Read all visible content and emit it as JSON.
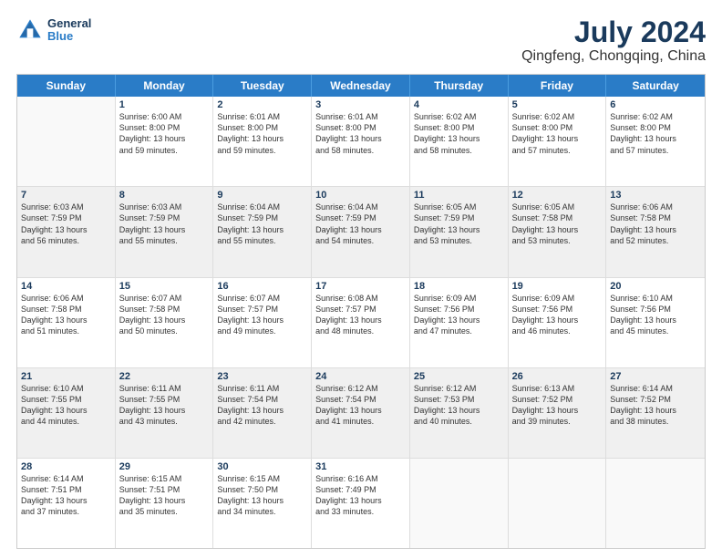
{
  "logo": {
    "line1": "General",
    "line2": "Blue"
  },
  "title": "July 2024",
  "subtitle": "Qingfeng, Chongqing, China",
  "weekdays": [
    "Sunday",
    "Monday",
    "Tuesday",
    "Wednesday",
    "Thursday",
    "Friday",
    "Saturday"
  ],
  "weeks": [
    [
      {
        "day": "",
        "content": [],
        "empty": true
      },
      {
        "day": "1",
        "content": [
          "Sunrise: 6:00 AM",
          "Sunset: 8:00 PM",
          "Daylight: 13 hours",
          "and 59 minutes."
        ]
      },
      {
        "day": "2",
        "content": [
          "Sunrise: 6:01 AM",
          "Sunset: 8:00 PM",
          "Daylight: 13 hours",
          "and 59 minutes."
        ]
      },
      {
        "day": "3",
        "content": [
          "Sunrise: 6:01 AM",
          "Sunset: 8:00 PM",
          "Daylight: 13 hours",
          "and 58 minutes."
        ]
      },
      {
        "day": "4",
        "content": [
          "Sunrise: 6:02 AM",
          "Sunset: 8:00 PM",
          "Daylight: 13 hours",
          "and 58 minutes."
        ]
      },
      {
        "day": "5",
        "content": [
          "Sunrise: 6:02 AM",
          "Sunset: 8:00 PM",
          "Daylight: 13 hours",
          "and 57 minutes."
        ]
      },
      {
        "day": "6",
        "content": [
          "Sunrise: 6:02 AM",
          "Sunset: 8:00 PM",
          "Daylight: 13 hours",
          "and 57 minutes."
        ]
      }
    ],
    [
      {
        "day": "7",
        "content": [
          "Sunrise: 6:03 AM",
          "Sunset: 7:59 PM",
          "Daylight: 13 hours",
          "and 56 minutes."
        ],
        "shaded": true
      },
      {
        "day": "8",
        "content": [
          "Sunrise: 6:03 AM",
          "Sunset: 7:59 PM",
          "Daylight: 13 hours",
          "and 55 minutes."
        ],
        "shaded": true
      },
      {
        "day": "9",
        "content": [
          "Sunrise: 6:04 AM",
          "Sunset: 7:59 PM",
          "Daylight: 13 hours",
          "and 55 minutes."
        ],
        "shaded": true
      },
      {
        "day": "10",
        "content": [
          "Sunrise: 6:04 AM",
          "Sunset: 7:59 PM",
          "Daylight: 13 hours",
          "and 54 minutes."
        ],
        "shaded": true
      },
      {
        "day": "11",
        "content": [
          "Sunrise: 6:05 AM",
          "Sunset: 7:59 PM",
          "Daylight: 13 hours",
          "and 53 minutes."
        ],
        "shaded": true
      },
      {
        "day": "12",
        "content": [
          "Sunrise: 6:05 AM",
          "Sunset: 7:58 PM",
          "Daylight: 13 hours",
          "and 53 minutes."
        ],
        "shaded": true
      },
      {
        "day": "13",
        "content": [
          "Sunrise: 6:06 AM",
          "Sunset: 7:58 PM",
          "Daylight: 13 hours",
          "and 52 minutes."
        ],
        "shaded": true
      }
    ],
    [
      {
        "day": "14",
        "content": [
          "Sunrise: 6:06 AM",
          "Sunset: 7:58 PM",
          "Daylight: 13 hours",
          "and 51 minutes."
        ]
      },
      {
        "day": "15",
        "content": [
          "Sunrise: 6:07 AM",
          "Sunset: 7:58 PM",
          "Daylight: 13 hours",
          "and 50 minutes."
        ]
      },
      {
        "day": "16",
        "content": [
          "Sunrise: 6:07 AM",
          "Sunset: 7:57 PM",
          "Daylight: 13 hours",
          "and 49 minutes."
        ]
      },
      {
        "day": "17",
        "content": [
          "Sunrise: 6:08 AM",
          "Sunset: 7:57 PM",
          "Daylight: 13 hours",
          "and 48 minutes."
        ]
      },
      {
        "day": "18",
        "content": [
          "Sunrise: 6:09 AM",
          "Sunset: 7:56 PM",
          "Daylight: 13 hours",
          "and 47 minutes."
        ]
      },
      {
        "day": "19",
        "content": [
          "Sunrise: 6:09 AM",
          "Sunset: 7:56 PM",
          "Daylight: 13 hours",
          "and 46 minutes."
        ]
      },
      {
        "day": "20",
        "content": [
          "Sunrise: 6:10 AM",
          "Sunset: 7:56 PM",
          "Daylight: 13 hours",
          "and 45 minutes."
        ]
      }
    ],
    [
      {
        "day": "21",
        "content": [
          "Sunrise: 6:10 AM",
          "Sunset: 7:55 PM",
          "Daylight: 13 hours",
          "and 44 minutes."
        ],
        "shaded": true
      },
      {
        "day": "22",
        "content": [
          "Sunrise: 6:11 AM",
          "Sunset: 7:55 PM",
          "Daylight: 13 hours",
          "and 43 minutes."
        ],
        "shaded": true
      },
      {
        "day": "23",
        "content": [
          "Sunrise: 6:11 AM",
          "Sunset: 7:54 PM",
          "Daylight: 13 hours",
          "and 42 minutes."
        ],
        "shaded": true
      },
      {
        "day": "24",
        "content": [
          "Sunrise: 6:12 AM",
          "Sunset: 7:54 PM",
          "Daylight: 13 hours",
          "and 41 minutes."
        ],
        "shaded": true
      },
      {
        "day": "25",
        "content": [
          "Sunrise: 6:12 AM",
          "Sunset: 7:53 PM",
          "Daylight: 13 hours",
          "and 40 minutes."
        ],
        "shaded": true
      },
      {
        "day": "26",
        "content": [
          "Sunrise: 6:13 AM",
          "Sunset: 7:52 PM",
          "Daylight: 13 hours",
          "and 39 minutes."
        ],
        "shaded": true
      },
      {
        "day": "27",
        "content": [
          "Sunrise: 6:14 AM",
          "Sunset: 7:52 PM",
          "Daylight: 13 hours",
          "and 38 minutes."
        ],
        "shaded": true
      }
    ],
    [
      {
        "day": "28",
        "content": [
          "Sunrise: 6:14 AM",
          "Sunset: 7:51 PM",
          "Daylight: 13 hours",
          "and 37 minutes."
        ]
      },
      {
        "day": "29",
        "content": [
          "Sunrise: 6:15 AM",
          "Sunset: 7:51 PM",
          "Daylight: 13 hours",
          "and 35 minutes."
        ]
      },
      {
        "day": "30",
        "content": [
          "Sunrise: 6:15 AM",
          "Sunset: 7:50 PM",
          "Daylight: 13 hours",
          "and 34 minutes."
        ]
      },
      {
        "day": "31",
        "content": [
          "Sunrise: 6:16 AM",
          "Sunset: 7:49 PM",
          "Daylight: 13 hours",
          "and 33 minutes."
        ]
      },
      {
        "day": "",
        "content": [],
        "empty": true
      },
      {
        "day": "",
        "content": [],
        "empty": true
      },
      {
        "day": "",
        "content": [],
        "empty": true
      }
    ]
  ]
}
